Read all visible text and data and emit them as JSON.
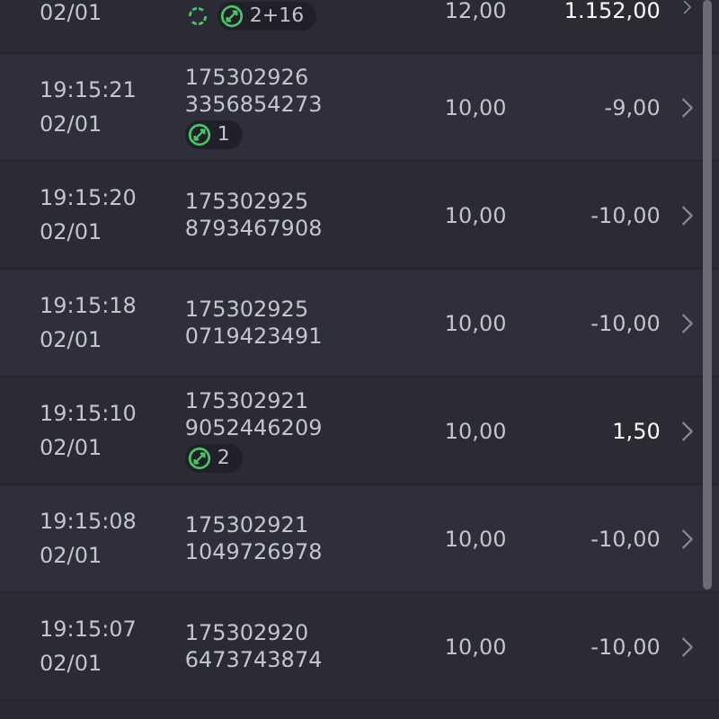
{
  "rows": [
    {
      "date": "02/01",
      "quantity": "12,00",
      "amount": "1.152,00",
      "highlighted": true,
      "badges": [
        {
          "kind": "refresh"
        },
        {
          "kind": "transfer",
          "count": "2+16"
        }
      ]
    },
    {
      "time": "19:15:21",
      "date": "02/01",
      "ids": [
        "175302926",
        "3356854273"
      ],
      "quantity": "10,00",
      "amount": "-9,00",
      "highlighted": false,
      "badges": [
        {
          "kind": "transfer",
          "count": "1"
        }
      ]
    },
    {
      "time": "19:15:20",
      "date": "02/01",
      "ids": [
        "175302925",
        "8793467908"
      ],
      "quantity": "10,00",
      "amount": "-10,00",
      "highlighted": false
    },
    {
      "time": "19:15:18",
      "date": "02/01",
      "ids": [
        "175302925",
        "0719423491"
      ],
      "quantity": "10,00",
      "amount": "-10,00",
      "highlighted": false
    },
    {
      "time": "19:15:10",
      "date": "02/01",
      "ids": [
        "175302921",
        "9052446209"
      ],
      "quantity": "10,00",
      "amount": "1,50",
      "highlighted": true,
      "badges": [
        {
          "kind": "transfer",
          "count": "2"
        }
      ]
    },
    {
      "time": "19:15:08",
      "date": "02/01",
      "ids": [
        "175302921",
        "1049726978"
      ],
      "quantity": "10,00",
      "amount": "-10,00",
      "highlighted": false
    },
    {
      "time": "19:15:07",
      "date": "02/01",
      "ids": [
        "175302920",
        "6473743874"
      ],
      "quantity": "10,00",
      "amount": "-10,00",
      "highlighted": false
    }
  ]
}
